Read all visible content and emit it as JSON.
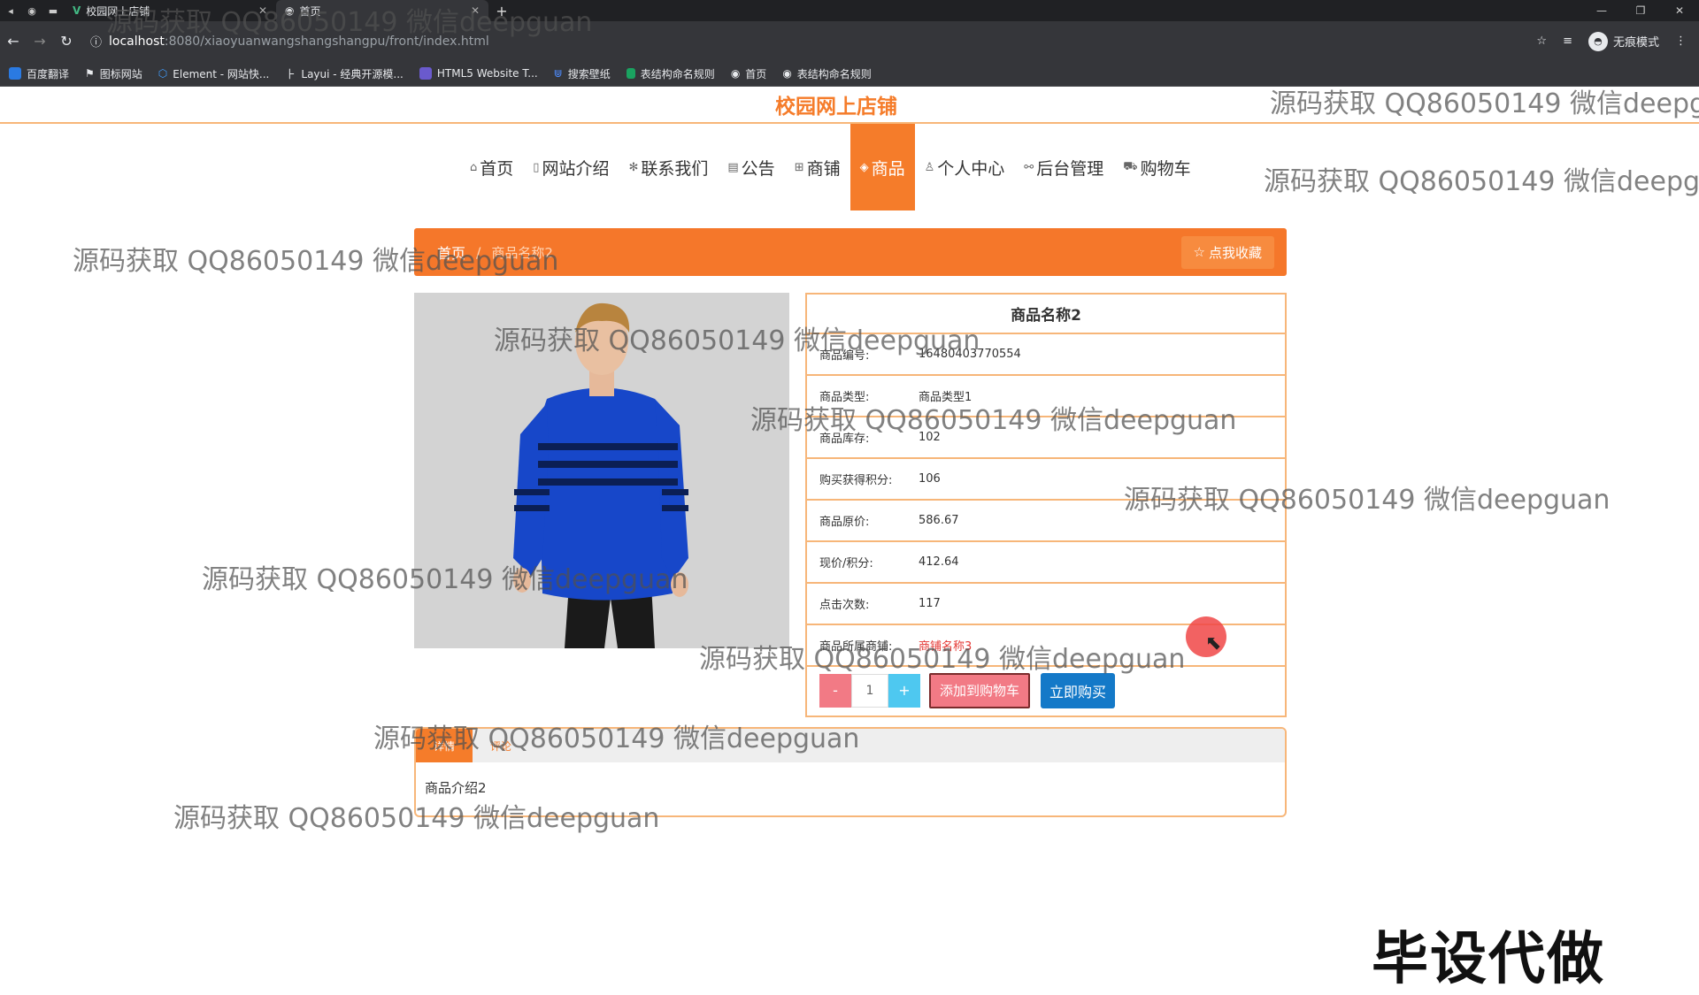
{
  "browser": {
    "tabs": [
      {
        "title": "校园网上店铺",
        "active": false
      },
      {
        "title": "首页",
        "active": true
      }
    ],
    "url_host": "localhost",
    "url_path": ":8080/xiaoyuanwangshangshangpu/front/index.html",
    "incognito_label": "无痕模式",
    "bookmarks": [
      {
        "label": "百度翻译",
        "color": "#2a7ae2"
      },
      {
        "label": "图标网站",
        "color": "#ffffff"
      },
      {
        "label": "Element - 网站快...",
        "color": "#409eff"
      },
      {
        "label": "Layui - 经典开源模...",
        "color": "#cccccc"
      },
      {
        "label": "HTML5 Website T...",
        "color": "#6a5acd"
      },
      {
        "label": "搜索壁纸",
        "color": "#4e8cff"
      },
      {
        "label": "表结构命名规则",
        "color": "#1aa260"
      },
      {
        "label": "首页",
        "color": "#e8eaed"
      },
      {
        "label": "表结构命名规则",
        "color": "#e8eaed"
      }
    ]
  },
  "site": {
    "title": "校园网上店铺",
    "nav": [
      {
        "label": "首页",
        "icon": "home-icon",
        "glyph": "⌂"
      },
      {
        "label": "网站介绍",
        "icon": "file-icon",
        "glyph": "▯"
      },
      {
        "label": "联系我们",
        "icon": "asterisk-icon",
        "glyph": "✻"
      },
      {
        "label": "公告",
        "icon": "notice-icon",
        "glyph": "▤"
      },
      {
        "label": "商铺",
        "icon": "grid-icon",
        "glyph": "⊞"
      },
      {
        "label": "商品",
        "icon": "tag-icon",
        "glyph": "◈"
      },
      {
        "label": "个人中心",
        "icon": "user-icon",
        "glyph": "♙"
      },
      {
        "label": "后台管理",
        "icon": "link-icon",
        "glyph": "⚯"
      },
      {
        "label": "购物车",
        "icon": "cart-icon",
        "glyph": "⛟"
      }
    ],
    "active_nav": "商品"
  },
  "breadcrumb": {
    "home": "首页",
    "separator": "/",
    "current": "商品名称2"
  },
  "favorite_label": "点我收藏",
  "product": {
    "name": "商品名称2",
    "fields": [
      {
        "label": "商品编号:",
        "value": "16480403770554"
      },
      {
        "label": "商品类型:",
        "value": "商品类型1"
      },
      {
        "label": "商品库存:",
        "value": "102"
      },
      {
        "label": "购买获得积分:",
        "value": "106"
      },
      {
        "label": "商品原价:",
        "value": "586.67"
      },
      {
        "label": "现价/积分:",
        "value": "412.64"
      },
      {
        "label": "点击次数:",
        "value": "117"
      },
      {
        "label": "商品所属商铺:",
        "value": "商铺名称3"
      }
    ],
    "quantity": "1",
    "minus_label": "-",
    "plus_label": "+",
    "add_to_cart_label": "添加到购物车",
    "buy_now_label": "立即购买"
  },
  "detail": {
    "tabs": [
      "详情",
      "评论"
    ],
    "content": "商品介绍2"
  },
  "overlay": {
    "watermark": "源码获取 QQ86050149 微信deepguan",
    "corner_text": "毕设代做"
  },
  "colors": {
    "accent": "#f57c2a",
    "border": "#f7b679",
    "buy": "#1479c8",
    "cart": "#f27a85",
    "plus": "#4ec8f0"
  }
}
